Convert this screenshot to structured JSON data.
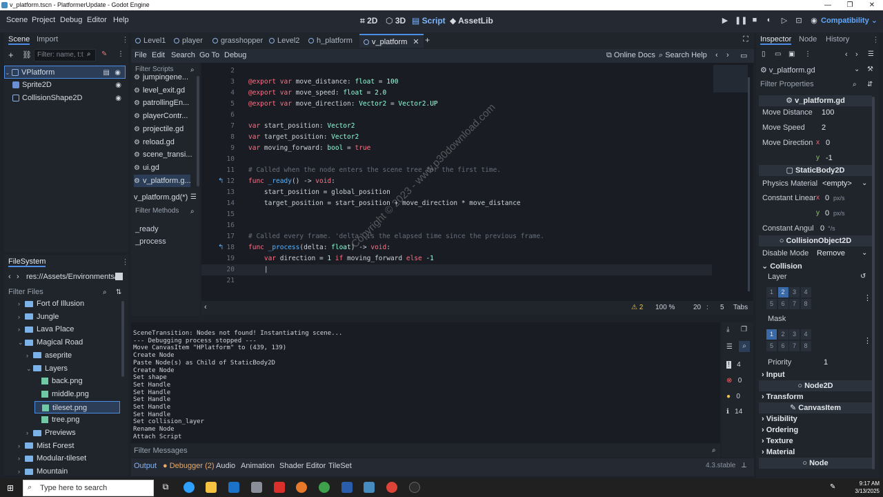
{
  "window": {
    "title": "v_platform.tscn - PlatformerUpdate - Godot Engine",
    "minimize": "—",
    "maximize": "❐",
    "close": "✕"
  },
  "menu": [
    "Scene",
    "Project",
    "Debug",
    "Editor",
    "Help"
  ],
  "workspaces": [
    {
      "label": "2D",
      "icon": "2d-icon"
    },
    {
      "label": "3D",
      "icon": "3d-icon"
    },
    {
      "label": "Script",
      "icon": "script-icon"
    },
    {
      "label": "AssetLib",
      "icon": "assetlib-icon"
    }
  ],
  "renderer": "Compatibility",
  "scene_dock": {
    "tabs": [
      "Scene",
      "Import"
    ],
    "filter_placeholder": "Filter: name, t:t",
    "nodes": [
      "VPlatform",
      "Sprite2D",
      "CollisionShape2D"
    ]
  },
  "filesystem": {
    "title": "FileSystem",
    "path": "res://Assets/Environments/",
    "filter_placeholder": "Filter Files",
    "items": [
      {
        "label": "Fort of Illusion",
        "kind": "folder",
        "indent": 1,
        "caret": "›"
      },
      {
        "label": "Jungle",
        "kind": "folder",
        "indent": 1,
        "caret": "›"
      },
      {
        "label": "Lava Place",
        "kind": "folder",
        "indent": 1,
        "caret": "›"
      },
      {
        "label": "Magical Road",
        "kind": "folder",
        "indent": 1,
        "caret": "⌄"
      },
      {
        "label": "aseprite",
        "kind": "folder",
        "indent": 2,
        "caret": "›"
      },
      {
        "label": "Layers",
        "kind": "folder",
        "indent": 2,
        "caret": "⌄"
      },
      {
        "label": "back.png",
        "kind": "file",
        "indent": 3,
        "caret": ""
      },
      {
        "label": "middle.png",
        "kind": "file",
        "indent": 3,
        "caret": ""
      },
      {
        "label": "tileset.png",
        "kind": "file",
        "indent": 3,
        "caret": "",
        "selected": true
      },
      {
        "label": "tree.png",
        "kind": "file",
        "indent": 3,
        "caret": ""
      },
      {
        "label": "Previews",
        "kind": "folder",
        "indent": 2,
        "caret": "›"
      },
      {
        "label": "Mist Forest",
        "kind": "folder",
        "indent": 1,
        "caret": "›"
      },
      {
        "label": "Modular-tileset",
        "kind": "folder",
        "indent": 1,
        "caret": "›"
      },
      {
        "label": "Mountain",
        "kind": "folder",
        "indent": 1,
        "caret": "›"
      }
    ]
  },
  "editor_tabs": [
    "Level1",
    "player",
    "grasshopper",
    "Level2",
    "h_platform",
    "v_platform"
  ],
  "script_menu": [
    "File",
    "Edit",
    "Search",
    "Go To",
    "Debug"
  ],
  "online_docs": "Online Docs",
  "search_help": "Search Help",
  "filter_scripts": "Filter Scripts",
  "scripts": [
    "jumpingene...",
    "level_exit.gd",
    "patrollingEn...",
    "playerContr...",
    "projectile.gd",
    "reload.gd",
    "scene_transi...",
    "ui.gd",
    "v_platform.g..."
  ],
  "current_script": "v_platform.gd(*)",
  "filter_methods": "Filter Methods",
  "methods": [
    "_ready",
    "_process"
  ],
  "code": [
    {
      "n": "2",
      "parts": []
    },
    {
      "n": "3",
      "parts": [
        [
          "kw",
          "@export "
        ],
        [
          "kw",
          "var "
        ],
        [
          "tx",
          "move_distance"
        ],
        [
          "tx",
          ": "
        ],
        [
          "ty",
          "float"
        ],
        [
          "tx",
          " = "
        ],
        [
          "num",
          "100"
        ]
      ]
    },
    {
      "n": "4",
      "parts": [
        [
          "kw",
          "@export "
        ],
        [
          "kw",
          "var "
        ],
        [
          "tx",
          "move_speed"
        ],
        [
          "tx",
          ": "
        ],
        [
          "ty",
          "float"
        ],
        [
          "tx",
          " = "
        ],
        [
          "num",
          "2.0"
        ]
      ]
    },
    {
      "n": "5",
      "parts": [
        [
          "kw",
          "@export "
        ],
        [
          "kw",
          "var "
        ],
        [
          "tx",
          "move_direction"
        ],
        [
          "tx",
          ": "
        ],
        [
          "ty",
          "Vector2"
        ],
        [
          "tx",
          " = "
        ],
        [
          "ty",
          "Vector2"
        ],
        [
          "tx",
          "."
        ],
        [
          "nm",
          "UP"
        ]
      ]
    },
    {
      "n": "6",
      "parts": []
    },
    {
      "n": "7",
      "parts": [
        [
          "kw",
          "var "
        ],
        [
          "tx",
          "start_position"
        ],
        [
          "tx",
          ": "
        ],
        [
          "ty",
          "Vector2"
        ]
      ]
    },
    {
      "n": "8",
      "parts": [
        [
          "kw",
          "var "
        ],
        [
          "tx",
          "target_position"
        ],
        [
          "tx",
          ": "
        ],
        [
          "ty",
          "Vector2"
        ]
      ]
    },
    {
      "n": "9",
      "parts": [
        [
          "kw",
          "var "
        ],
        [
          "tx",
          "moving_forward"
        ],
        [
          "tx",
          ": "
        ],
        [
          "ty",
          "bool"
        ],
        [
          "tx",
          " = "
        ],
        [
          "kw",
          "true"
        ]
      ]
    },
    {
      "n": "10",
      "parts": []
    },
    {
      "n": "11",
      "parts": [
        [
          "cm",
          "# Called when the node enters the scene tree for the first time."
        ]
      ]
    },
    {
      "n": "12",
      "parts": [
        [
          "kw",
          "func "
        ],
        [
          "fn",
          "_ready"
        ],
        [
          "tx",
          "() -> "
        ],
        [
          "kw",
          "void"
        ],
        [
          "tx",
          ":"
        ]
      ]
    },
    {
      "n": "13",
      "parts": [
        [
          "tx",
          "    start_position = global_position"
        ]
      ]
    },
    {
      "n": "14",
      "parts": [
        [
          "tx",
          "    target_position = start_position + move_direction * move_distance"
        ]
      ]
    },
    {
      "n": "15",
      "parts": []
    },
    {
      "n": "16",
      "parts": []
    },
    {
      "n": "17",
      "parts": [
        [
          "cm",
          "# Called every frame. 'delta' is the elapsed time since the previous frame."
        ]
      ]
    },
    {
      "n": "18",
      "parts": [
        [
          "kw",
          "func "
        ],
        [
          "fn",
          "_process"
        ],
        [
          "tx",
          "(delta: "
        ],
        [
          "ty",
          "float"
        ],
        [
          "tx",
          ") -> "
        ],
        [
          "kw",
          "void"
        ],
        [
          "tx",
          ":"
        ]
      ]
    },
    {
      "n": "19",
      "parts": [
        [
          "tx",
          "    "
        ],
        [
          "kw",
          "var "
        ],
        [
          "tx",
          "direction = "
        ],
        [
          "num",
          "1"
        ],
        [
          "kw",
          " if "
        ],
        [
          "tx",
          "moving_forward "
        ],
        [
          "kw",
          "else "
        ],
        [
          "num",
          "-1"
        ]
      ]
    },
    {
      "n": "20",
      "parts": [
        [
          "tx",
          "    |"
        ]
      ]
    },
    {
      "n": "21",
      "parts": []
    }
  ],
  "status": {
    "warnings": "2",
    "zoom": "100 %",
    "line": "20",
    "sep": ":",
    "col": "5",
    "indent": "Tabs"
  },
  "output_lines": [
    "SceneTransition: Nodes not found! Instantiating scene...",
    "--- Debugging process stopped ---",
    "Move CanvasItem \"HPlatform\" to (439, 139)",
    "Create Node",
    "Paste Node(s) as Child of StaticBody2D",
    "Create Node",
    "Set shape",
    "Set Handle",
    "Set Handle",
    "Set Handle",
    "Set Handle",
    "Set Handle",
    "Set collision_layer",
    "Rename Node",
    "Attach Script"
  ],
  "output_counts": {
    "messages": "4",
    "errors": "0",
    "warnings": "0",
    "editor": "14"
  },
  "filter_messages": "Filter Messages",
  "bottom_tabs": [
    "Output",
    "Debugger (2)",
    "Audio",
    "Animation",
    "Shader Editor",
    "TileSet"
  ],
  "version": "4.3.stable",
  "inspector": {
    "tabs": [
      "Inspector",
      "Node",
      "History"
    ],
    "resource": "v_platform.gd",
    "filter_placeholder": "Filter Properties",
    "script_header": "v_platform.gd",
    "move_distance_label": "Move Distance",
    "move_distance": "100",
    "move_speed_label": "Move Speed",
    "move_speed": "2",
    "move_direction_label": "Move Direction",
    "x_label": "x",
    "y_label": "y",
    "dir_x": "0",
    "dir_y": "-1",
    "staticbody_header": "StaticBody2D",
    "physics_material_label": "Physics Material",
    "physics_material": "<empty>",
    "constant_linear_label": "Constant Linear",
    "cl_x": "0",
    "cl_y": "0",
    "px_unit": "px/s",
    "constant_angular_label": "Constant Angul",
    "ca": "0",
    "deg_unit": "°/s",
    "collision_obj_header": "CollisionObject2D",
    "disable_mode_label": "Disable Mode",
    "disable_mode": "Remove",
    "collision_section": "Collision",
    "layer_label": "Layer",
    "mask_label": "Mask",
    "grid_numbers": [
      "1",
      "2",
      "3",
      "4",
      "5",
      "6",
      "7",
      "8"
    ],
    "priority_label": "Priority",
    "priority": "1",
    "input_section": "Input",
    "node2d_header": "Node2D",
    "transform_section": "Transform",
    "canvasitem_header": "CanvasItem",
    "visibility_section": "Visibility",
    "ordering_section": "Ordering",
    "texture_section": "Texture",
    "material_section": "Material",
    "node_header": "Node"
  },
  "watermark": "Copyright © 2023 - www.p30download.com",
  "taskbar": {
    "search_placeholder": "Type here to search",
    "time": "9:17 AM",
    "date": "3/13/2025"
  },
  "colors": {
    "accent": "#4d8ee8",
    "background": "#1d2229"
  }
}
